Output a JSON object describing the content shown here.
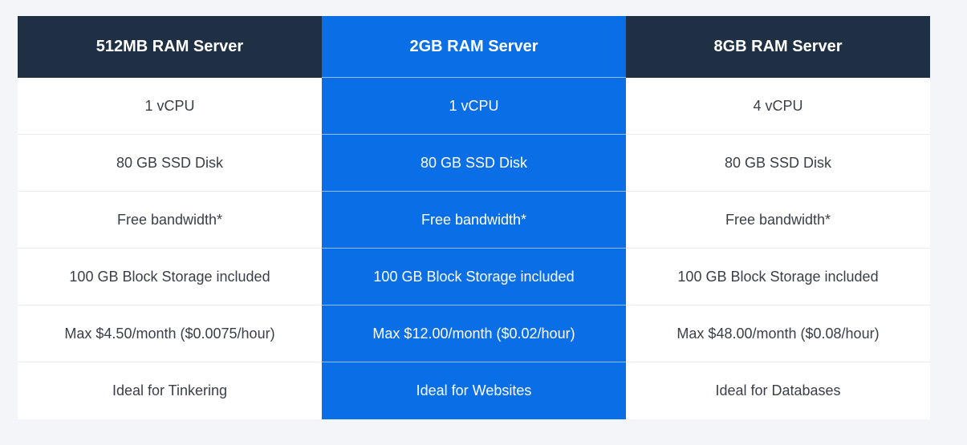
{
  "colors": {
    "page_background": "#f3f5f9",
    "header_dark": "#1f3045",
    "featured_blue": "#0a6ee6",
    "text_dark": "#3a3f47",
    "text_light": "#ffffff"
  },
  "plans": [
    {
      "title": "512MB RAM Server",
      "featured": false,
      "features": [
        "1 vCPU",
        "80 GB SSD Disk",
        "Free bandwidth*",
        "100 GB Block Storage included",
        "Max $4.50/month ($0.0075/hour)",
        "Ideal for Tinkering"
      ]
    },
    {
      "title": "2GB RAM Server",
      "featured": true,
      "features": [
        "1 vCPU",
        "80 GB SSD Disk",
        "Free bandwidth*",
        "100 GB Block Storage included",
        "Max $12.00/month ($0.02/hour)",
        "Ideal for Websites"
      ]
    },
    {
      "title": "8GB RAM Server",
      "featured": false,
      "features": [
        "4 vCPU",
        "80 GB SSD Disk",
        "Free bandwidth*",
        "100 GB Block Storage included",
        "Max $48.00/month ($0.08/hour)",
        "Ideal for Databases"
      ]
    }
  ]
}
